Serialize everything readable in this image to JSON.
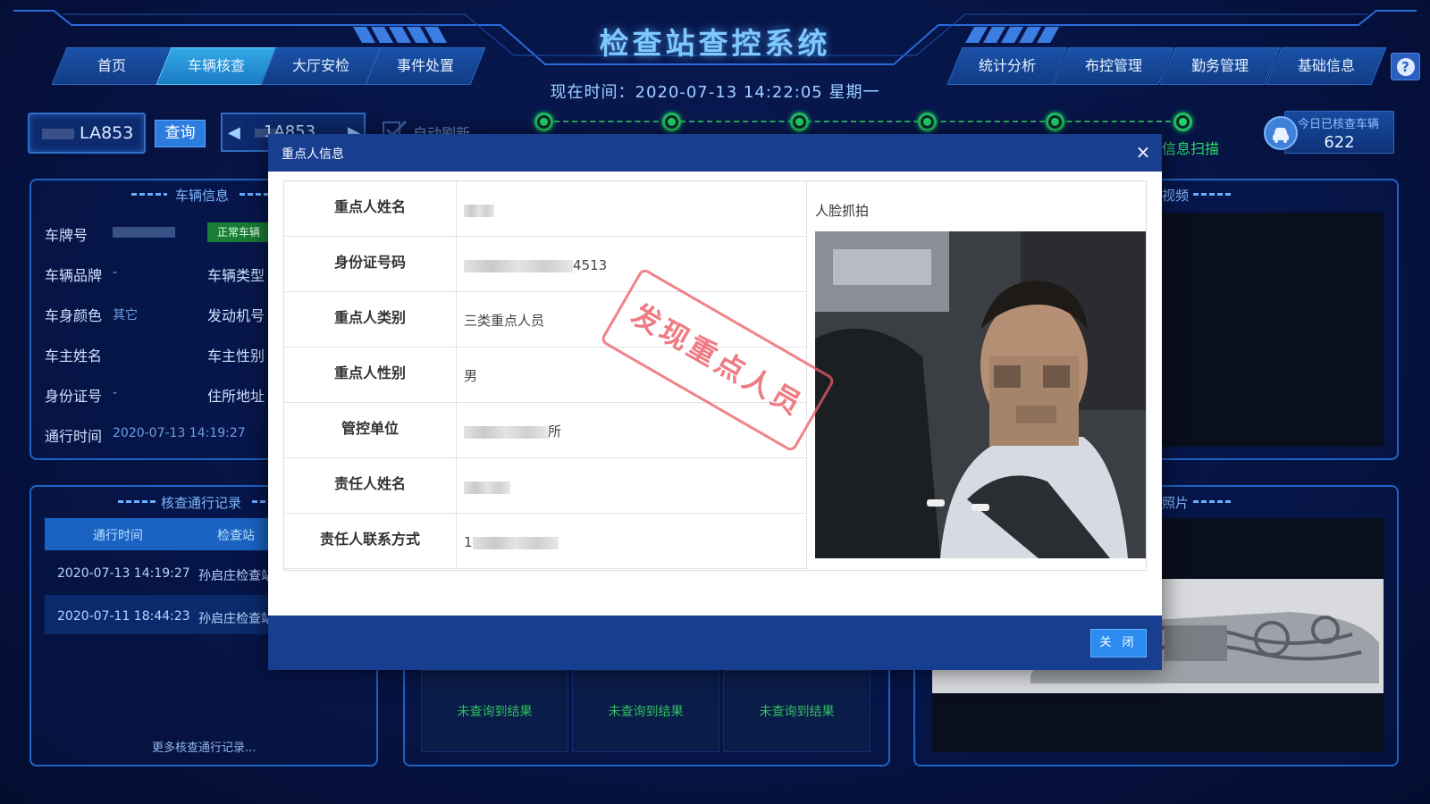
{
  "app": {
    "title": "检查站查控系统",
    "clock": "现在时间：2020-07-13  14:22:05  星期一",
    "help_label": "?"
  },
  "nav": {
    "left_tabs": [
      {
        "label": "首页",
        "active": false
      },
      {
        "label": "车辆核查",
        "active": true
      },
      {
        "label": "大厅安检",
        "active": false
      },
      {
        "label": "事件处置",
        "active": false
      }
    ],
    "right_tabs": [
      {
        "label": "统计分析"
      },
      {
        "label": "布控管理"
      },
      {
        "label": "勤务管理"
      },
      {
        "label": "基础信息"
      }
    ]
  },
  "toolbar": {
    "plate_value": "LA853",
    "query_label": "查询",
    "nav_plate": "1A853",
    "auto_refresh_label": "自动刷新",
    "scan_label": "信息扫描",
    "today_checked_label": "今日已核查车辆",
    "today_checked_value": "622"
  },
  "vehicle_info": {
    "title": "车辆信息",
    "badge": "正常车辆",
    "fields": [
      {
        "label": "车牌号",
        "value": ""
      },
      {
        "label": "车辆品牌",
        "value": "-"
      },
      {
        "label": "车辆类型",
        "value": ""
      },
      {
        "label": "车身颜色",
        "value": "其它"
      },
      {
        "label": "发动机号",
        "value": ""
      },
      {
        "label": "车主姓名",
        "value": ""
      },
      {
        "label": "车主性别",
        "value": ""
      },
      {
        "label": "身份证号",
        "value": "-"
      },
      {
        "label": "住所地址",
        "value": ""
      },
      {
        "label": "通行时间",
        "value": "2020-07-13 14:19:27"
      }
    ]
  },
  "records": {
    "title": "核查通行记录",
    "col_time": "通行时间",
    "col_station": "检查站",
    "rows": [
      {
        "time": "2020-07-13 14:19:27",
        "station": "孙启庄检查站"
      },
      {
        "time": "2020-07-11 18:44:23",
        "station": "孙启庄检查站"
      }
    ],
    "more": "更多核查通行记录..."
  },
  "results": {
    "labels": [
      "未查询到结果",
      "未查询到结果",
      "未查询到结果"
    ]
  },
  "right_panels": {
    "video_title": "视频",
    "photo_title": "照片"
  },
  "modal": {
    "title": "重点人信息",
    "close_icon": "×",
    "rows": [
      {
        "label": "重点人姓名",
        "value": ""
      },
      {
        "label": "身份证号码",
        "value": "4513"
      },
      {
        "label": "重点人类别",
        "value": "三类重点人员"
      },
      {
        "label": "重点人性别",
        "value": "男"
      },
      {
        "label": "管控单位",
        "value": "所"
      },
      {
        "label": "责任人姓名",
        "value": ""
      },
      {
        "label": "责任人联系方式",
        "value": "1"
      }
    ],
    "face_label": "人脸抓拍",
    "stamp": "发现重点人员",
    "footer_button": "关 闭"
  },
  "colors": {
    "bg": "#061445",
    "accent": "#1f63c4",
    "active_tab": "#33a8e6",
    "status_green": "#20c060",
    "modal_header": "#183e8f",
    "stamp_red": "#eb5a64"
  }
}
